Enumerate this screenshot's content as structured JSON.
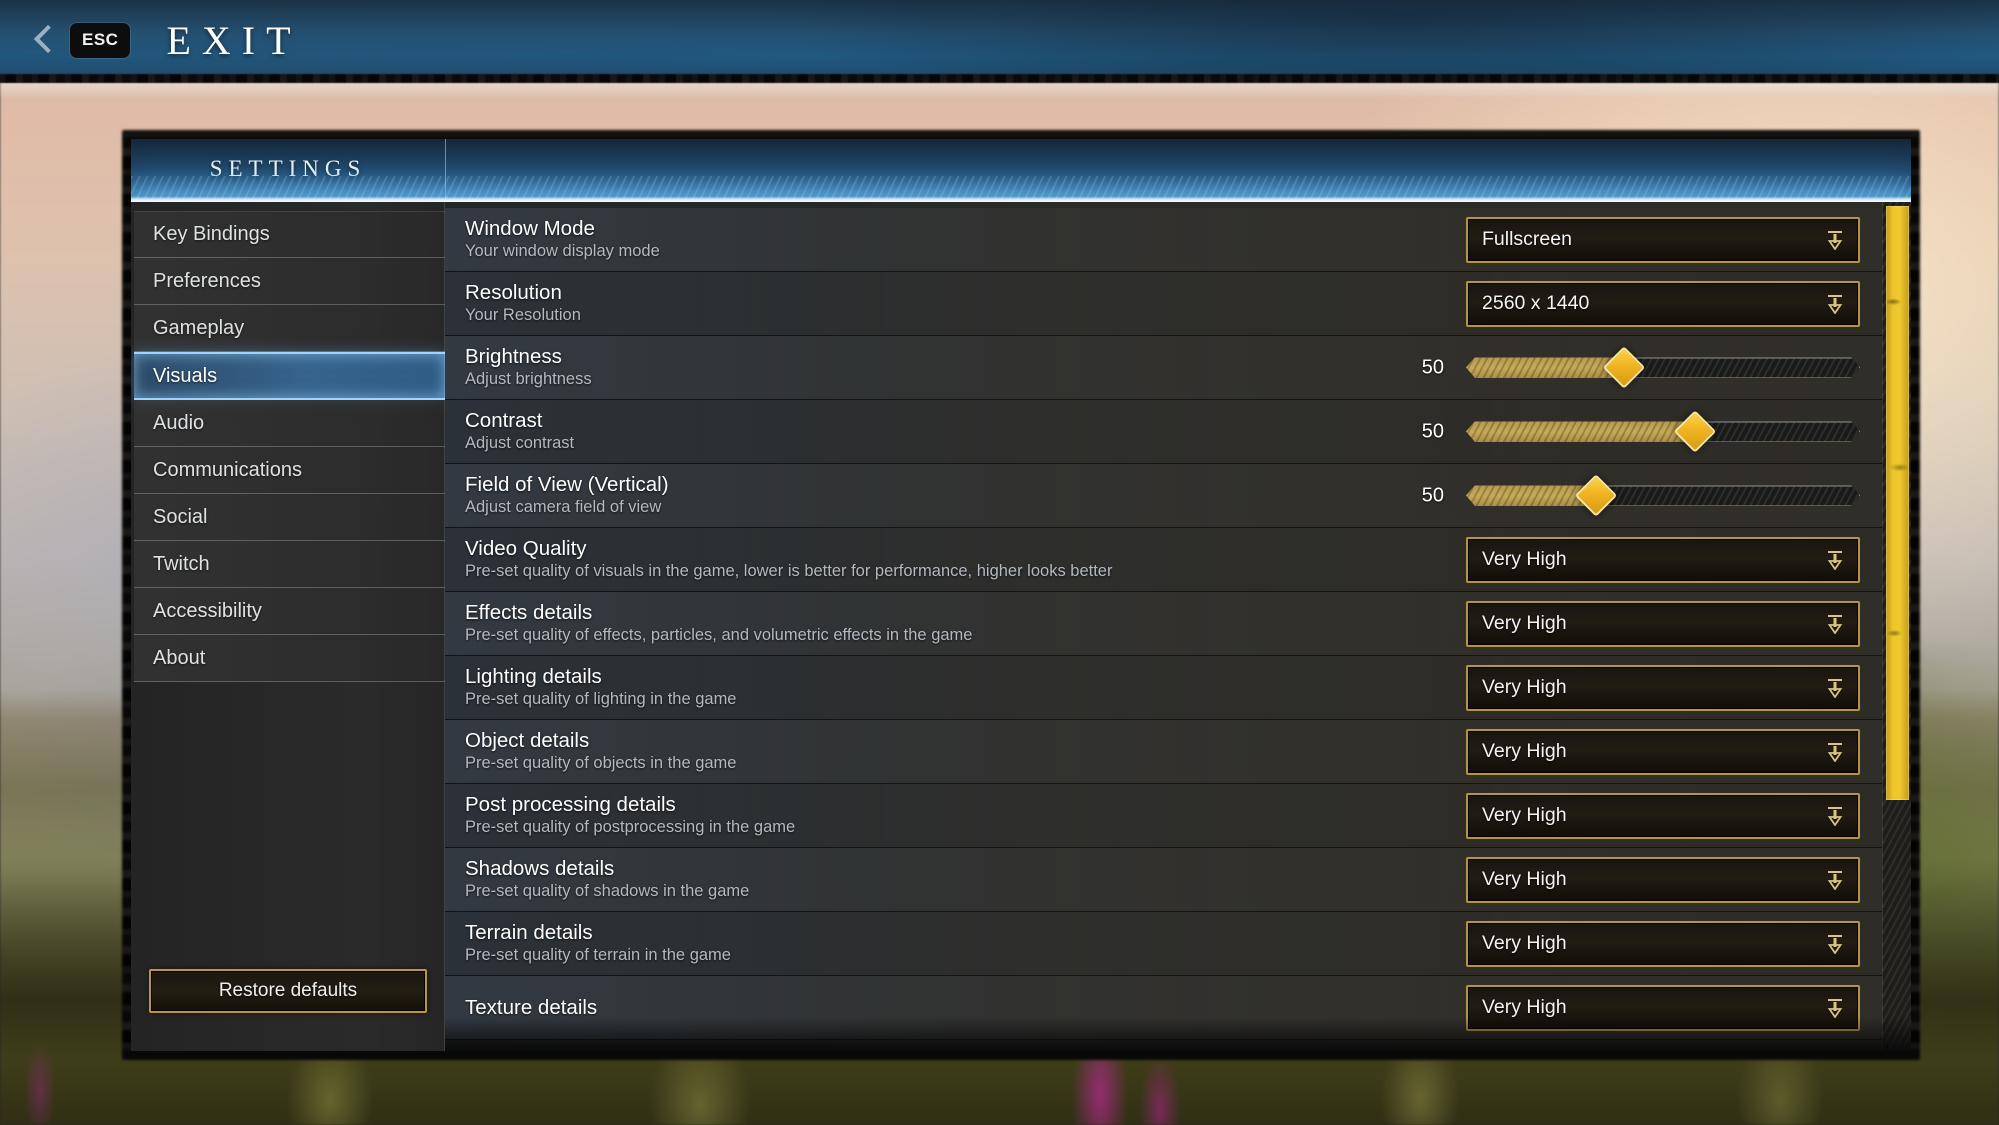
{
  "topbar": {
    "back_icon": "chevron-left-icon",
    "esc_key": "ESC",
    "title": "EXIT"
  },
  "panel": {
    "title": "SETTINGS"
  },
  "sidebar": {
    "items": [
      {
        "label": "Key Bindings",
        "selected": false
      },
      {
        "label": "Preferences",
        "selected": false
      },
      {
        "label": "Gameplay",
        "selected": false
      },
      {
        "label": "Visuals",
        "selected": true
      },
      {
        "label": "Audio",
        "selected": false
      },
      {
        "label": "Communications",
        "selected": false
      },
      {
        "label": "Social",
        "selected": false
      },
      {
        "label": "Twitch",
        "selected": false
      },
      {
        "label": "Accessibility",
        "selected": false
      },
      {
        "label": "About",
        "selected": false
      }
    ],
    "restore_label": "Restore defaults"
  },
  "settings_rows": [
    {
      "title": "Window Mode",
      "desc": "Your window display mode",
      "control": "dropdown",
      "value": "Fullscreen"
    },
    {
      "title": "Resolution",
      "desc": "Your Resolution",
      "control": "dropdown",
      "value": "2560 x 1440"
    },
    {
      "title": "Brightness",
      "desc": "Adjust brightness",
      "control": "slider",
      "value": "50",
      "fill_pct": 40
    },
    {
      "title": "Contrast",
      "desc": "Adjust contrast",
      "control": "slider",
      "value": "50",
      "fill_pct": 58
    },
    {
      "title": "Field of View (Vertical)",
      "desc": "Adjust camera field of view",
      "control": "slider",
      "value": "50",
      "fill_pct": 33
    },
    {
      "title": "Video Quality",
      "desc": "Pre-set quality of visuals in the game, lower is better for performance, higher looks better",
      "control": "dropdown",
      "value": "Very High"
    },
    {
      "title": "Effects details",
      "desc": "Pre-set quality of effects, particles, and volumetric effects in the game",
      "control": "dropdown",
      "value": "Very High"
    },
    {
      "title": "Lighting details",
      "desc": "Pre-set quality of lighting in the game",
      "control": "dropdown",
      "value": "Very High"
    },
    {
      "title": "Object details",
      "desc": "Pre-set quality of objects in the game",
      "control": "dropdown",
      "value": "Very High"
    },
    {
      "title": "Post processing details",
      "desc": "Pre-set quality of postprocessing in the game",
      "control": "dropdown",
      "value": "Very High"
    },
    {
      "title": "Shadows details",
      "desc": "Pre-set quality of shadows in the game",
      "control": "dropdown",
      "value": "Very High"
    },
    {
      "title": "Terrain details",
      "desc": "Pre-set quality of terrain in the game",
      "control": "dropdown",
      "value": "Very High"
    },
    {
      "title": "Texture details",
      "desc": "",
      "control": "dropdown",
      "value": "Very High"
    }
  ],
  "scrollbar": {
    "thumb_pct": 70
  },
  "colors": {
    "accent_gold": "#b59442",
    "highlight_blue": "#9fd4ff",
    "header_blue": "#255a84",
    "scroll_thumb": "#f0c92e"
  }
}
